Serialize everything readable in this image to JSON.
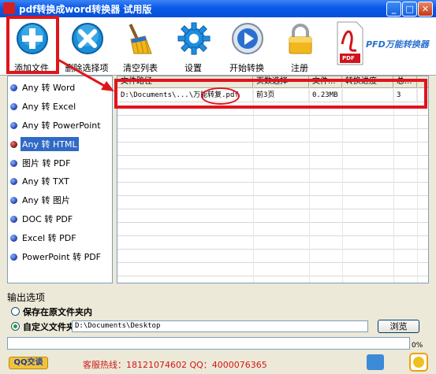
{
  "window": {
    "title": "pdf转换成word转换器 试用版"
  },
  "toolbar": {
    "add_files": "添加文件",
    "remove_selected": "删除选择项",
    "clear_list": "清空列表",
    "settings": "设置",
    "start_convert": "开始转换",
    "register": "注册",
    "brand": "PFD万能转换器",
    "pdf_badge": "PDF"
  },
  "conversion_types": [
    {
      "label": "Any 转 Word",
      "selected": false
    },
    {
      "label": "Any 转 Excel",
      "selected": false
    },
    {
      "label": "Any 转 PowerPoint",
      "selected": false
    },
    {
      "label": "Any 转 HTML",
      "selected": true
    },
    {
      "label": "图片 转 PDF",
      "selected": false
    },
    {
      "label": "Any 转 TXT",
      "selected": false
    },
    {
      "label": "Any 转 图片",
      "selected": false
    },
    {
      "label": "DOC 转 PDF",
      "selected": false
    },
    {
      "label": "Excel 转 PDF",
      "selected": false
    },
    {
      "label": "PowerPoint 转 PDF",
      "selected": false
    }
  ],
  "file_table": {
    "columns": [
      "文件路径",
      "页数选择",
      "文件...",
      "转换进度",
      "总..."
    ],
    "rows": [
      {
        "path": "D:\\Documents\\...\\万能转复.pdf",
        "pages": "前3页",
        "size": "0.23MB",
        "progress": "",
        "total": "3"
      }
    ]
  },
  "output": {
    "section_label": "输出选项",
    "option_same_folder": "保存在原文件夹内",
    "option_custom_folder": "自定义文件夹",
    "selected_option": "custom",
    "custom_path": "D:\\Documents\\Desktop",
    "browse_label": "浏览"
  },
  "progress": {
    "value": 0,
    "text": "0%"
  },
  "footer": {
    "qq_label": "QQ交谈",
    "hotline": "客服热线：18121074602 QQ：4000076365"
  },
  "colors": {
    "accent_red": "#e0141c",
    "selection_blue": "#316ac5",
    "titlebar_blue": "#0a5ae8"
  }
}
